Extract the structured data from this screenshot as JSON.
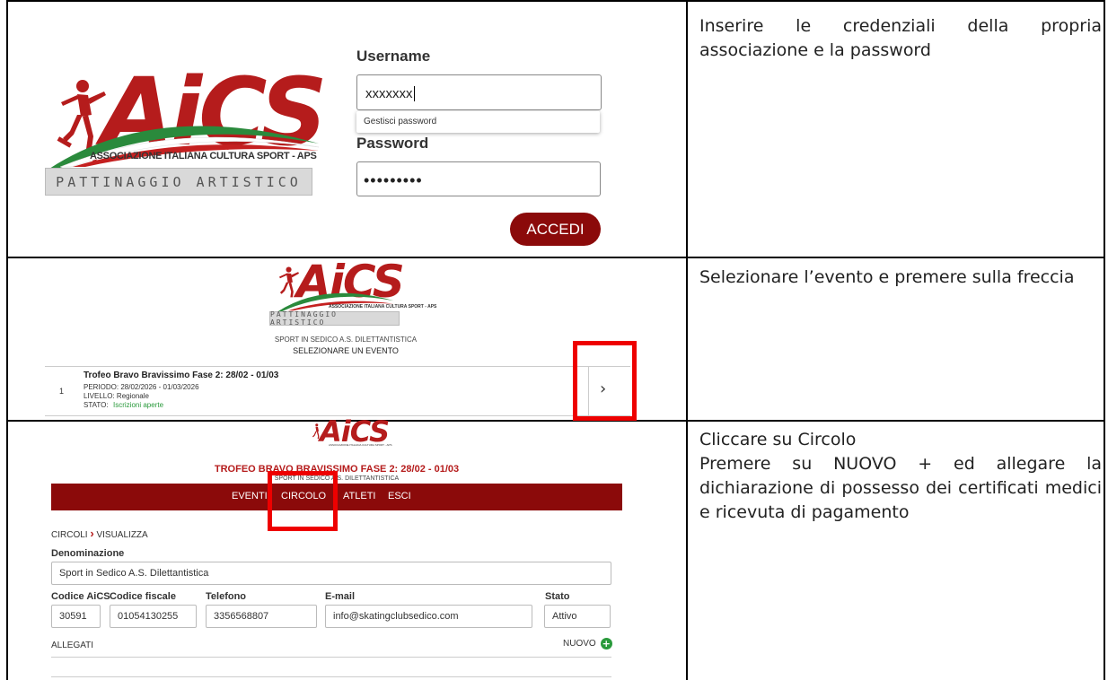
{
  "rows": [
    {
      "instruction": "Inserire le credenziali della propria associazione e la password",
      "login": {
        "logo": {
          "word": "AiCS",
          "subtitle": "ASSOCIAZIONE ITALIANA CULTURA SPORT - APS",
          "banner": "PATTINAGGIO ARTISTICO"
        },
        "username_label": "Username",
        "username_value": "xxxxxxx",
        "autocomplete_hint": "Gestisci password",
        "password_label": "Password",
        "password_value": "•••••••••",
        "login_button": "ACCEDI"
      }
    },
    {
      "instruction": "Selezionare l’evento e premere sulla freccia",
      "event_select": {
        "logo": {
          "word": "AiCS",
          "subtitle": "ASSOCIAZIONE ITALIANA CULTURA SPORT - APS",
          "banner": "PATTINAGGIO ARTISTICO"
        },
        "association": "SPORT IN SEDICO A.S. DILETTANTISTICA",
        "heading": "SELEZIONARE UN EVENTO",
        "event": {
          "number": "1",
          "title": "Trofeo Bravo Bravissimo Fase 2: 28/02 - 01/03",
          "period": "PERIODO: 28/02/2026 - 01/03/2026",
          "level": "LIVELLO: Regionale",
          "status_label": "STATO:",
          "status_value": "Iscrizioni aperte",
          "arrow": "›"
        }
      }
    },
    {
      "instruction_line1": "Cliccare su Circolo",
      "instruction_line2": "Premere su NUOVO + ed allegare la dichiarazione di possesso dei certificati medici e ricevuta di pagamento",
      "circolo": {
        "logo": {
          "word": "AiCS",
          "subtitle": "ASSOCIAZIONE ITALIANA CULTURA SPORT - APS"
        },
        "event_title": "TROFEO BRAVO BRAVISSIMO FASE 2: 28/02 - 01/03",
        "association": "SPORT IN SEDICO A.S. DILETTANTISTICA",
        "nav": [
          "EVENTI",
          "CIRCOLO",
          "ATLETI",
          "ESCI"
        ],
        "breadcrumb_root": "CIRCOLI",
        "breadcrumb_sep": "›",
        "breadcrumb_current": "VISUALIZZA",
        "fields": {
          "denominazione_label": "Denominazione",
          "denominazione_value": "Sport in Sedico A.S. Dilettantistica",
          "codice_aics_label": "Codice AiCS",
          "codice_aics_value": "30591",
          "codice_fiscale_label": "Codice fiscale",
          "codice_fiscale_value": "01054130255",
          "telefono_label": "Telefono",
          "telefono_value": "3356568807",
          "email_label": "E-mail",
          "email_value": "info@skatingclubsedico.com",
          "stato_label": "Stato",
          "stato_value": "Attivo"
        },
        "attachments_label": "ALLEGATI",
        "new_button": "NUOVO",
        "new_icon_glyph": "+"
      }
    }
  ],
  "colors": {
    "brand_red": "#b51c1c",
    "dark_red": "#8b0a0a",
    "highlight_red": "#e00000",
    "green": "#2a9a3c"
  }
}
